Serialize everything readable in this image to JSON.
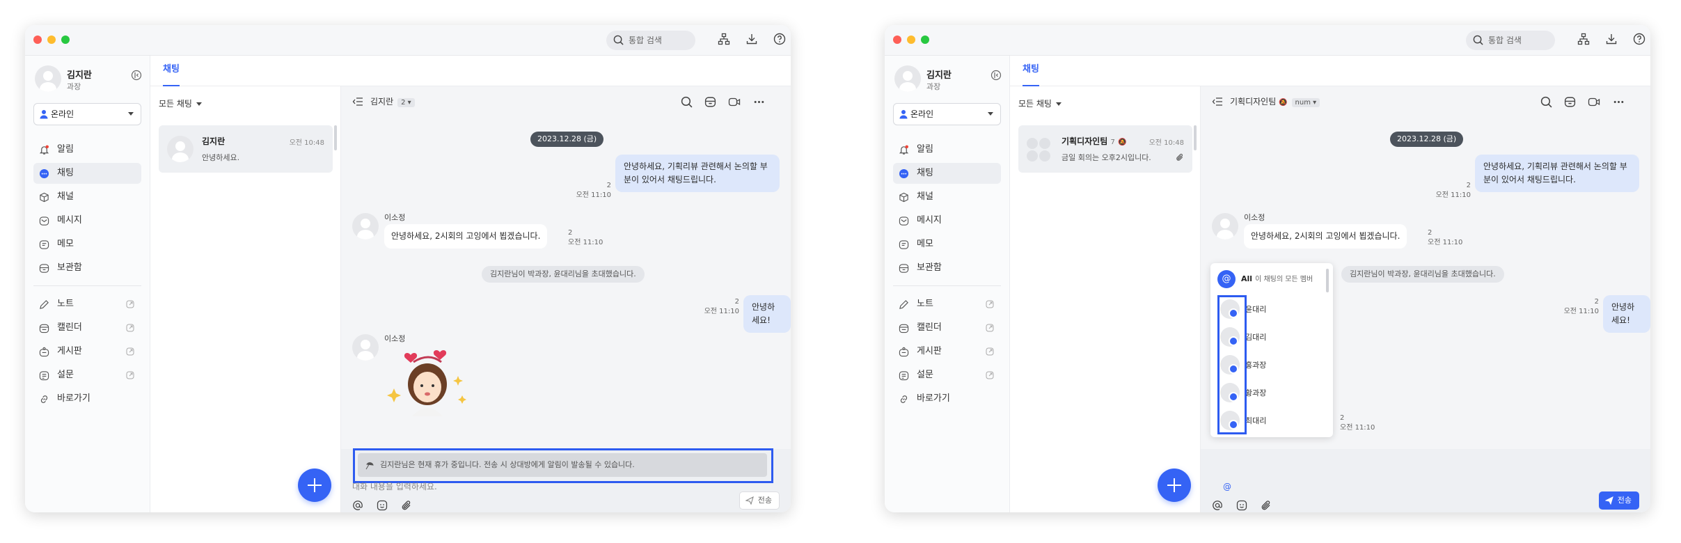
{
  "titlebar": {
    "search_placeholder": "통합 검색"
  },
  "profile": {
    "name": "김지란",
    "rank": "과장",
    "status": "온라인"
  },
  "nav": {
    "main": [
      "알림",
      "채팅",
      "채널",
      "메시지",
      "메모",
      "보관함"
    ],
    "external": [
      "노트",
      "캘린더",
      "게시판",
      "설문"
    ],
    "shortcut": "바로가기"
  },
  "tab_label": "채팅",
  "filter_label": "모든 채팅",
  "window1": {
    "room": {
      "name": "김지란",
      "time": "오전 10:48",
      "preview": "안녕하세요."
    },
    "chat_title": "김지란",
    "member_count": "2",
    "date": "2023.12.28 (금)",
    "msg1": {
      "text": "안녕하세요, 기획리뷰 관련해서 논의할 부분이 있어서 채팅드립니다.",
      "unread": "2",
      "time": "오전 11:10"
    },
    "sender": "이소정",
    "msg2": {
      "text": "안녕하세요, 2시회의 고잉에서 뵙겠습니다.",
      "unread": "2",
      "time": "오전 11:10"
    },
    "system": "김지란님이 박과장, 윤대리님을 초대했습니다.",
    "msg3": {
      "text": "안녕하세요!",
      "unread": "2",
      "time": "오전 11:10"
    },
    "sender2": "이소정",
    "notice": "김지란님은 현재 휴가 중입니다. 전송 시 상대방에게 알림이 발송될 수 있습니다.",
    "input_placeholder": "대화 내용을 입력하세요.",
    "send": "전송"
  },
  "window2": {
    "room": {
      "name": "기획디자인팀",
      "count": "7",
      "time": "오전 10:48",
      "preview": "금일 회의는 오후2시입니다."
    },
    "chat_title": "기획디자인팀",
    "member_badge": "num",
    "date": "2023.12.28 (금)",
    "msg1": {
      "text": "안녕하세요, 기획리뷰 관련해서 논의할 부분이 있어서 채팅드립니다.",
      "unread": "2",
      "time": "오전 11:10"
    },
    "sender": "이소정",
    "msg2": {
      "text": "안녕하세요, 2시회의 고잉에서 뵙겠습니다.",
      "unread": "2",
      "time": "오전 11:10"
    },
    "system": "김지란님이 박과장, 윤대리님을 초대했습니다.",
    "msg3": {
      "text": "안녕하세요!",
      "unread": "2",
      "time": "오전 11:10"
    },
    "meta_after_sticker": {
      "unread": "2",
      "time": "오전 11:10"
    },
    "input_value": "@",
    "send": "전송",
    "mention": {
      "all_label": "All",
      "all_desc": "이 채팅의 모든 멤버",
      "members": [
        "윤대리",
        "김대리",
        "홍과장",
        "황과장",
        "최대리"
      ]
    }
  },
  "colors": {
    "accent": "#3563f5",
    "highlight": "#2d5bf0"
  }
}
